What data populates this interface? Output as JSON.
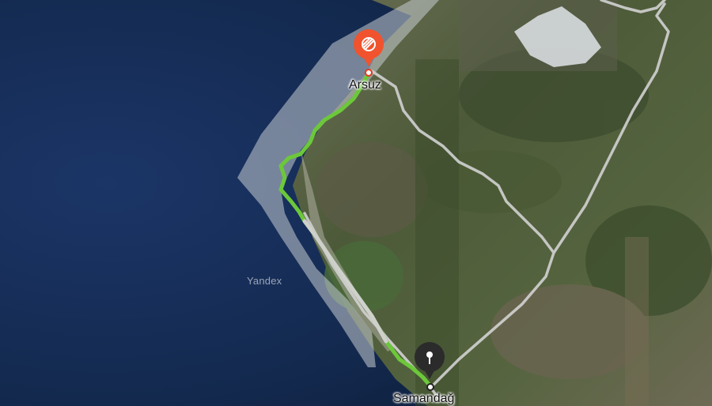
{
  "map": {
    "brand": "Yandex",
    "route": {
      "start": {
        "label": "Arsuz",
        "marker_color": "#f0532d"
      },
      "end": {
        "label": "Samandağ",
        "marker_color": "#2b2b2b"
      },
      "route_color": "#6cc83a",
      "road_color": "#cfcfcf"
    },
    "colors": {
      "sea": "#0f2243",
      "land": "#4e5a3c",
      "mountains": "#5c6b46"
    }
  }
}
